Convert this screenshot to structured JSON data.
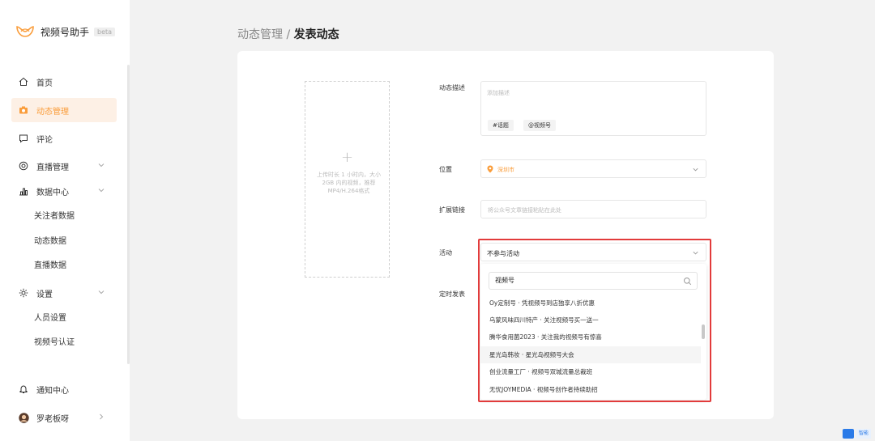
{
  "app": {
    "title": "视频号助手",
    "badge": "beta",
    "brand_color": "#fa9d3b"
  },
  "sidebar": {
    "items": [
      {
        "label": "首页",
        "icon": "home-icon"
      },
      {
        "label": "动态管理",
        "icon": "camera-icon",
        "active": true
      },
      {
        "label": "评论",
        "icon": "comment-icon"
      },
      {
        "label": "直播管理",
        "icon": "live-icon"
      },
      {
        "label": "数据中心",
        "icon": "chart-icon"
      },
      {
        "label": "设置",
        "icon": "gear-icon"
      }
    ],
    "data_sub": [
      "关注者数据",
      "动态数据",
      "直播数据"
    ],
    "settings_sub": [
      "人员设置",
      "视频号认证"
    ],
    "bottom": {
      "notify": "通知中心",
      "user": "罗老板呀"
    }
  },
  "breadcrumb": {
    "parent": "动态管理",
    "separator": " / ",
    "current": "发表动态"
  },
  "upload": {
    "plus": "+",
    "tip": "上传时长 1 小时内，大小 2GB 内的视频，推荐MP4/H.264格式"
  },
  "form": {
    "desc_label": "动态描述",
    "desc_placeholder": "添加描述",
    "topic_btn": "#话题",
    "mention_btn": "@视频号",
    "location_label": "位置",
    "location_value": "深圳市",
    "link_label": "扩展链接",
    "link_placeholder": "将公众号文章链接粘贴在此处",
    "activity_label": "活动",
    "activity_value": "不参与活动",
    "schedule_label": "定时发表"
  },
  "dropdown": {
    "search_value": "视频号",
    "options": [
      "Oy定制号 · 凭视频号到店独享八折优惠",
      "乌蒙风味四川特产 · 关注视频号买一送一",
      "腾华食用菌2023 · 关注我的视频号有惊喜",
      "星光岛韩妆 · 星光岛视频号大会",
      "创业流量工厂 · 视频号双城流量总裁班",
      "无忧JOYMEDIA · 视频号创作者持续助招"
    ],
    "hovered_index": 3
  },
  "float_widget": {
    "label": "智能"
  },
  "colors": {
    "highlight": "#e23b3b",
    "active_bg": "#fdf0e5"
  }
}
